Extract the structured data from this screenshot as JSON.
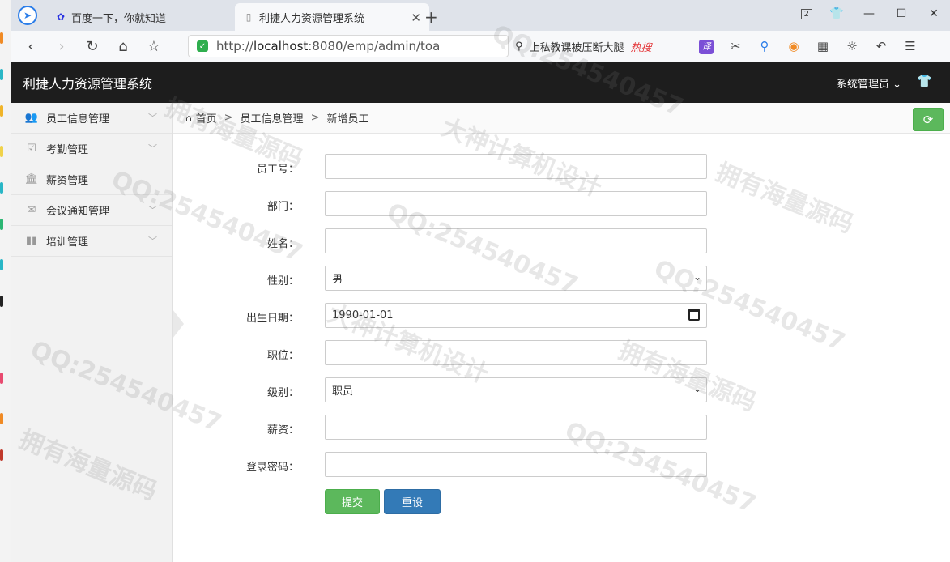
{
  "browser": {
    "tabs": [
      {
        "title": "百度一下，你就知道",
        "active": false,
        "icon": "paw-icon"
      },
      {
        "title": "利捷人力资源管理系统",
        "active": true,
        "icon": "page-icon"
      }
    ],
    "tab_count_badge": "2",
    "url_prefix": "http://",
    "url_host": "localhost",
    "url_rest": ":8080/emp/admin/toa",
    "search_hint": "上私教课被压断大腿",
    "search_hot": "热搜",
    "translate_label": "译"
  },
  "header": {
    "title": "利捷人力资源管理系统",
    "user_label": "系统管理员"
  },
  "sidebar": {
    "items": [
      {
        "label": "员工信息管理",
        "icon": "users-icon",
        "has_children": true
      },
      {
        "label": "考勤管理",
        "icon": "clipboard-check-icon",
        "has_children": true
      },
      {
        "label": "薪资管理",
        "icon": "bank-icon",
        "has_children": false
      },
      {
        "label": "会议通知管理",
        "icon": "envelope-icon",
        "has_children": true
      },
      {
        "label": "培训管理",
        "icon": "books-icon",
        "has_children": true
      }
    ]
  },
  "breadcrumb": {
    "home": "首页",
    "level1": "员工信息管理",
    "level2": "新增员工"
  },
  "form": {
    "fields": [
      {
        "label": "员工号：",
        "type": "text",
        "value": ""
      },
      {
        "label": "部门：",
        "type": "text",
        "value": ""
      },
      {
        "label": "姓名：",
        "type": "text",
        "value": ""
      },
      {
        "label": "性别：",
        "type": "select",
        "value": "男"
      },
      {
        "label": "出生日期：",
        "type": "date",
        "value": "1990-01-01"
      },
      {
        "label": "职位：",
        "type": "text",
        "value": ""
      },
      {
        "label": "级别：",
        "type": "select",
        "value": "职员"
      },
      {
        "label": "薪资：",
        "type": "text",
        "value": ""
      },
      {
        "label": "登录密码：",
        "type": "password",
        "value": ""
      }
    ],
    "submit_label": "提交",
    "reset_label": "重设"
  },
  "watermark": {
    "texts": [
      "QQ:254540457",
      "拥有海量源码",
      "大神计算机设计"
    ]
  },
  "colors": {
    "header_bg": "#1d1d1d",
    "success": "#5cb85c",
    "primary": "#337ab7",
    "sidebar_bg": "#f2f2f2"
  }
}
